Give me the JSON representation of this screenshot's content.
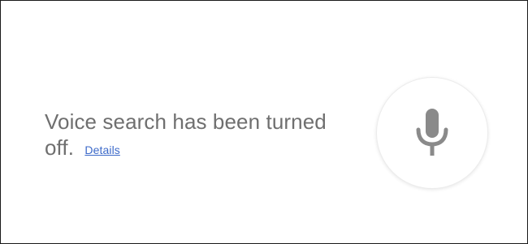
{
  "message": {
    "text": "Voice search has been turned off.",
    "details_link": "Details"
  },
  "mic": {
    "icon": "microphone-icon",
    "color": "#8a8a8a"
  },
  "colors": {
    "text": "#6f6f6f",
    "link": "#3d6ac9",
    "border": "#1a1a1a"
  }
}
